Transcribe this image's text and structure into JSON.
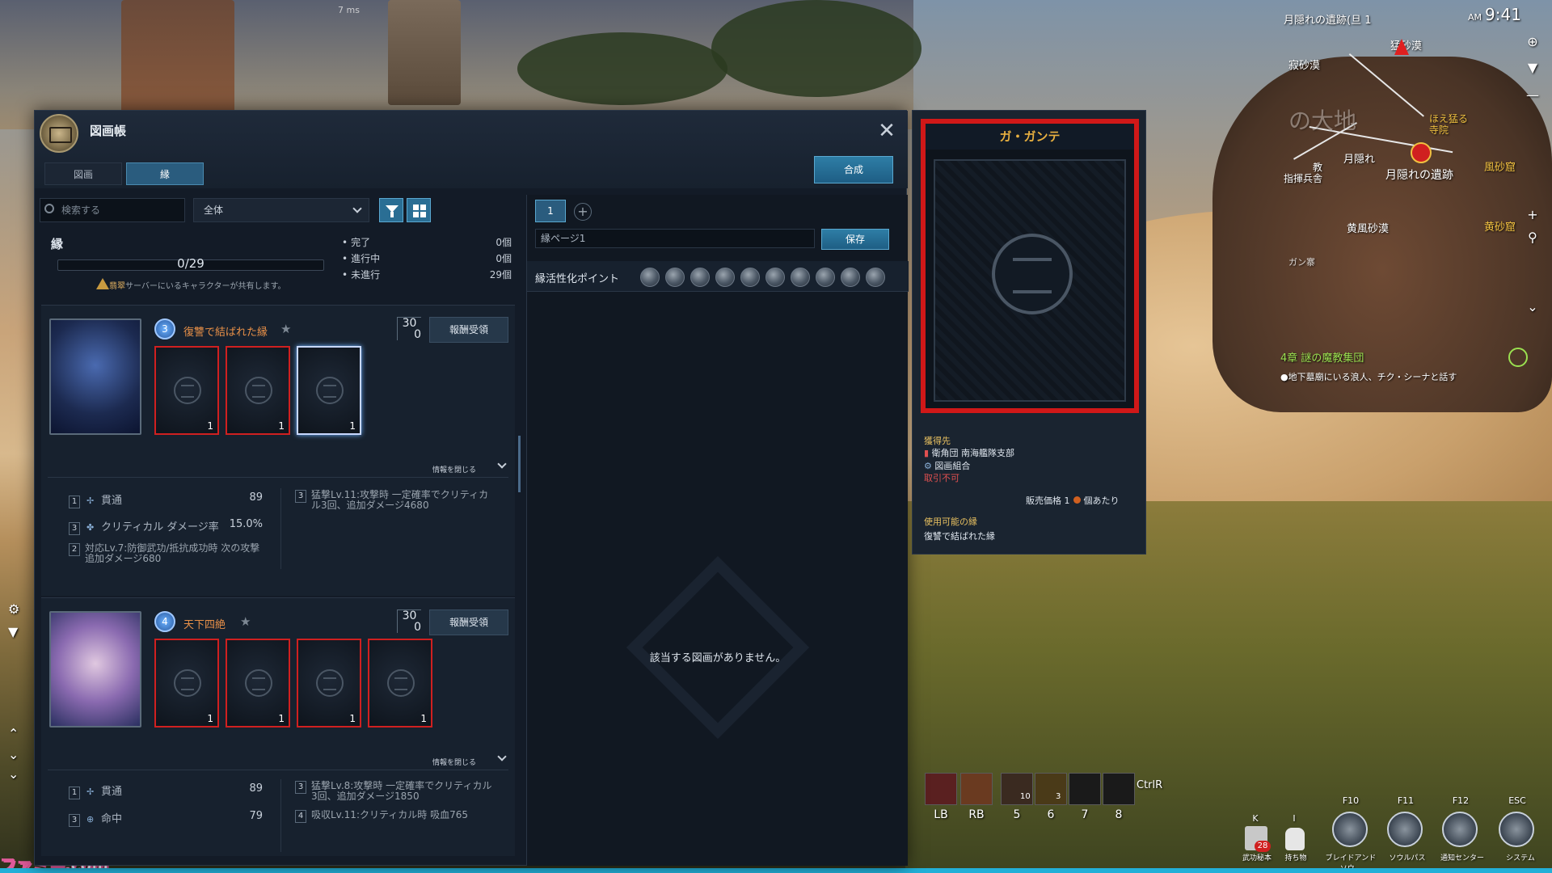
{
  "hud": {
    "fps": "7 ms",
    "clock_ampm": "AM",
    "clock_time": "9:41",
    "region": "月隠れの遺跡(旦 1",
    "minimap_labels": [
      "寂砂漠",
      "猛砂漠",
      "ほえ猛る\n寺院",
      "の大地",
      "月隠れ",
      "月隠れの遺跡",
      "教\n指揮兵舎",
      "黄風砂漠",
      "黄砂窟",
      "風砂窟",
      "ガン寨"
    ],
    "quest_title": "4章  謎の魔教集団",
    "quest_sub": "●地下墓廟にいる浪人、チク・シーナと話す",
    "hotbar_keys": [
      "LB",
      "RB",
      "5",
      "6",
      "7",
      "8"
    ],
    "hotbar_counts": [
      "10",
      "3"
    ],
    "ctrl_label": "CtrlR",
    "system_buttons": [
      {
        "key": "K",
        "label": "武功秘本",
        "badge": "28"
      },
      {
        "key": "I",
        "label": "持ち物"
      },
      {
        "key": "F10",
        "label": "ブレイドアンドソウ..."
      },
      {
        "key": "F11",
        "label": "ソウルパス"
      },
      {
        "key": "F12",
        "label": "通知センター"
      },
      {
        "key": "ESC",
        "label": "システム"
      }
    ],
    "watermark": "ファミ通.com"
  },
  "window": {
    "title": "図画帳",
    "close": "✕",
    "tabs": [
      "図画",
      "縁"
    ],
    "synth_button": "合成"
  },
  "filters": {
    "search_placeholder": "検索する",
    "select_value": "全体"
  },
  "summary": {
    "section_label": "縁",
    "progress_text": "0/29",
    "progress": 0,
    "share_note_warn": "翡翠",
    "share_note": "サーバーにいるキャラクターが共有します。",
    "stats": [
      {
        "label": "完了",
        "value": "0個"
      },
      {
        "label": "進行中",
        "value": "0個"
      },
      {
        "label": "未進行",
        "value": "29個"
      }
    ]
  },
  "sets": [
    {
      "badge": "3",
      "name": "復讐で結ばれた縁",
      "score_top": "30",
      "score_bottom": "0",
      "reward_button": "報酬受領",
      "card_counts": [
        "1",
        "1",
        "1"
      ],
      "collapse_label": "情報を閉じる",
      "effects": [
        {
          "lv": "1",
          "icon": "penetration-icon",
          "name": "貫通",
          "value": "89"
        },
        {
          "lv": "3",
          "icon": "critical-damage-icon",
          "name": "クリティカル ダメージ率",
          "value": "15.0%"
        }
      ],
      "effect_long_left": {
        "lv": "2",
        "text": "対応Lv.7:防御武功/抵抗成功時 次の攻撃 追加ダメージ680"
      },
      "effect_long_right": {
        "lv": "3",
        "text": "猛撃Lv.11:攻撃時 一定確率でクリティカル3回、追加ダメージ4680"
      }
    },
    {
      "badge": "4",
      "name": "天下四絶",
      "score_top": "30",
      "score_bottom": "0",
      "reward_button": "報酬受領",
      "card_counts": [
        "1",
        "1",
        "1",
        "1"
      ],
      "collapse_label": "情報を閉じる",
      "effects": [
        {
          "lv": "1",
          "icon": "penetration-icon",
          "name": "貫通",
          "value": "89"
        },
        {
          "lv": "3",
          "icon": "accuracy-icon",
          "name": "命中",
          "value": "79"
        }
      ],
      "effect_long_right": {
        "lv": "3",
        "text": "猛撃Lv.8:攻撃時 一定確率でクリティカル3回、追加ダメージ1850"
      },
      "effect_long_right2": {
        "lv": "4",
        "text": "吸収Lv.11:クリティカル時 吸血765"
      }
    }
  ],
  "right_pane": {
    "page_tab": "1",
    "add": "+",
    "page_name": "縁ページ1",
    "save_button": "保存",
    "points_label": "縁活性化ポイント",
    "empty_message": "該当する図画がありません。"
  },
  "detail": {
    "card_title": "ガ・ガンテ",
    "source_label": "獲得先",
    "source_1": "衛角団 南海艦隊支部",
    "source_2": "図画組合",
    "untradeable": "取引不可",
    "price_label": "販売価格",
    "price_value": "1",
    "price_unit": "個あたり",
    "usable_label": "使用可能の縁",
    "usable_value": "復讐で結ばれた縁"
  },
  "colors": {
    "accent": "#2e7ea6",
    "card_border": "#d01818",
    "set_name": "#e89048",
    "card_title": "#e8b040"
  }
}
